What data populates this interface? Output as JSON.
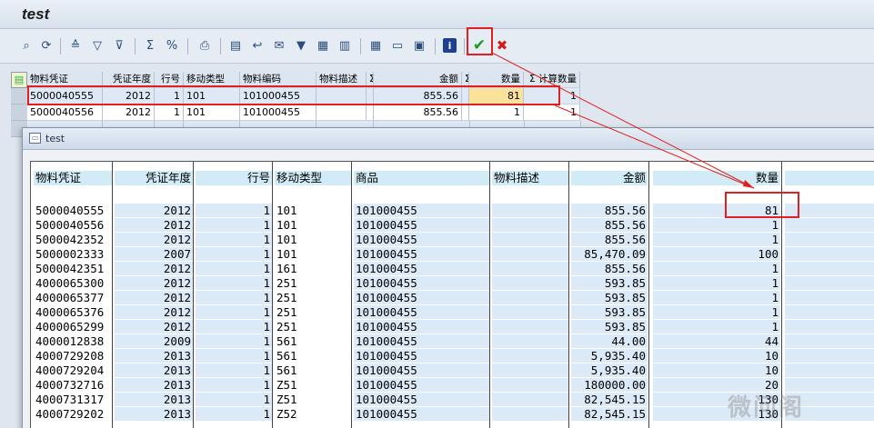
{
  "window": {
    "title": "test"
  },
  "toolbar": {
    "icons": [
      "details-icon",
      "refresh-icon",
      "first-page-icon",
      "filter-icon",
      "filter-set-icon",
      "sum-icon",
      "subtotal-icon",
      "print-icon",
      "export-icon",
      "local-file-icon",
      "mail-icon",
      "abc-icon",
      "graphic-icon",
      "layout-icon",
      "choose-layout-icon",
      "save-layout-icon",
      "info-icon",
      "check-icon",
      "cancel-icon"
    ],
    "ok_glyph": "✔",
    "cancel_glyph": "✖",
    "info_glyph": "i"
  },
  "bg_grid": {
    "headers": [
      "物料凭证",
      "凭证年度",
      "行号",
      "移动类型",
      "物料编码",
      "物料描述",
      "Σ",
      "金额",
      "Σ",
      "数量",
      "Σ 计算数量"
    ],
    "rows": [
      [
        "5000040555",
        "2012",
        "1",
        "101",
        "101000455",
        "",
        "",
        "855.56",
        "",
        "81",
        "1"
      ],
      [
        "5000040556",
        "2012",
        "1",
        "101",
        "101000455",
        "",
        "",
        "855.56",
        "",
        "1",
        "1"
      ]
    ]
  },
  "dialog": {
    "title": "test",
    "headers": [
      "物料凭证",
      "凭证年度",
      "行号",
      "移动类型",
      "商品",
      "物料描述",
      "金额",
      "数量"
    ],
    "rows": [
      [
        "5000040555",
        "2012",
        "1",
        "101",
        "101000455",
        "",
        "855.56",
        "81"
      ],
      [
        "5000040556",
        "2012",
        "1",
        "101",
        "101000455",
        "",
        "855.56",
        "1"
      ],
      [
        "5000042352",
        "2012",
        "1",
        "101",
        "101000455",
        "",
        "855.56",
        "1"
      ],
      [
        "5000002333",
        "2007",
        "1",
        "101",
        "101000455",
        "",
        "85,470.09",
        "100"
      ],
      [
        "5000042351",
        "2012",
        "1",
        "161",
        "101000455",
        "",
        "855.56",
        "1"
      ],
      [
        "4000065300",
        "2012",
        "1",
        "251",
        "101000455",
        "",
        "593.85",
        "1"
      ],
      [
        "4000065377",
        "2012",
        "1",
        "251",
        "101000455",
        "",
        "593.85",
        "1"
      ],
      [
        "4000065376",
        "2012",
        "1",
        "251",
        "101000455",
        "",
        "593.85",
        "1"
      ],
      [
        "4000065299",
        "2012",
        "1",
        "251",
        "101000455",
        "",
        "593.85",
        "1"
      ],
      [
        "4000012838",
        "2009",
        "1",
        "561",
        "101000455",
        "",
        "44.00",
        "44"
      ],
      [
        "4000729208",
        "2013",
        "1",
        "561",
        "101000455",
        "",
        "5,935.40",
        "10"
      ],
      [
        "4000729204",
        "2013",
        "1",
        "561",
        "101000455",
        "",
        "5,935.40",
        "10"
      ],
      [
        "4000732716",
        "2013",
        "1",
        "Z51",
        "101000455",
        "",
        "180000.00",
        "20"
      ],
      [
        "4000731317",
        "2013",
        "1",
        "Z51",
        "101000455",
        "",
        "82,545.15",
        "130"
      ],
      [
        "4000729202",
        "2013",
        "1",
        "Z52",
        "101000455",
        "",
        "82,545.15",
        "130"
      ]
    ]
  },
  "watermark": "微问阁",
  "colors": {
    "highlight": "#e02020",
    "header_band": "#d2ecf7",
    "row_band": "#dce9f6",
    "qty_cell": "#fbe29a"
  }
}
